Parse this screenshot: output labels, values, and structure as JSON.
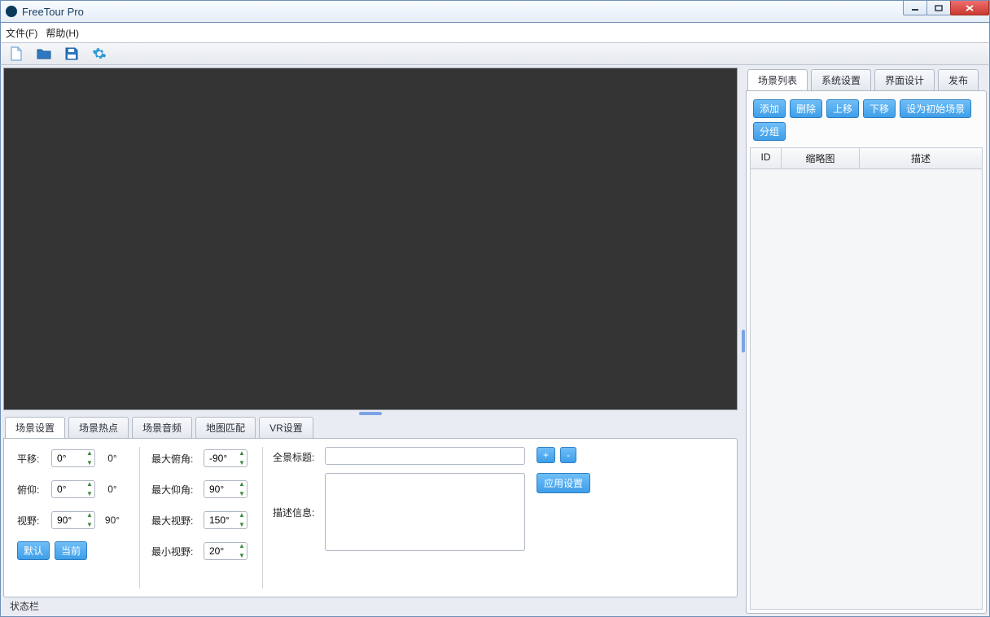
{
  "app": {
    "title": "FreeTour Pro"
  },
  "menu": {
    "file": "文件(F)",
    "help": "帮助(H)"
  },
  "toolbar_icons": {
    "new": "new-file-icon",
    "open": "open-folder-icon",
    "save": "save-disk-icon",
    "settings": "gear-icon"
  },
  "bottom_tabs": [
    "场景设置",
    "场景热点",
    "场景音频",
    "地图匹配",
    "VR设置"
  ],
  "scene_settings": {
    "pan_label": "平移:",
    "pan_value": "0°",
    "pan_readout": "0°",
    "tilt_label": "俯仰:",
    "tilt_value": "0°",
    "tilt_readout": "0°",
    "fov_label": "视野:",
    "fov_value": "90°",
    "fov_readout": "90°",
    "default_btn": "默认",
    "current_btn": "当前",
    "max_tilt_label": "最大俯角:",
    "max_tilt_value": "-90°",
    "min_tilt_label": "最大仰角:",
    "min_tilt_value": "90°",
    "max_fov_label": "最大视野:",
    "max_fov_value": "150°",
    "min_fov_label": "最小视野:",
    "min_fov_value": "20°",
    "pano_title_label": "全景标题:",
    "pano_title_value": "",
    "desc_label": "描述信息:",
    "desc_value": "",
    "plus": "+",
    "minus": "-",
    "apply": "应用设置"
  },
  "statusbar": {
    "text": "状态栏"
  },
  "right_tabs": [
    "场景列表",
    "系统设置",
    "界面设计",
    "发布"
  ],
  "right_toolbar": {
    "add": "添加",
    "delete": "删除",
    "up": "上移",
    "down": "下移",
    "set_initial": "设为初始场景",
    "group": "分组"
  },
  "table": {
    "col_id": "ID",
    "col_thumb": "缩略图",
    "col_desc": "描述"
  }
}
